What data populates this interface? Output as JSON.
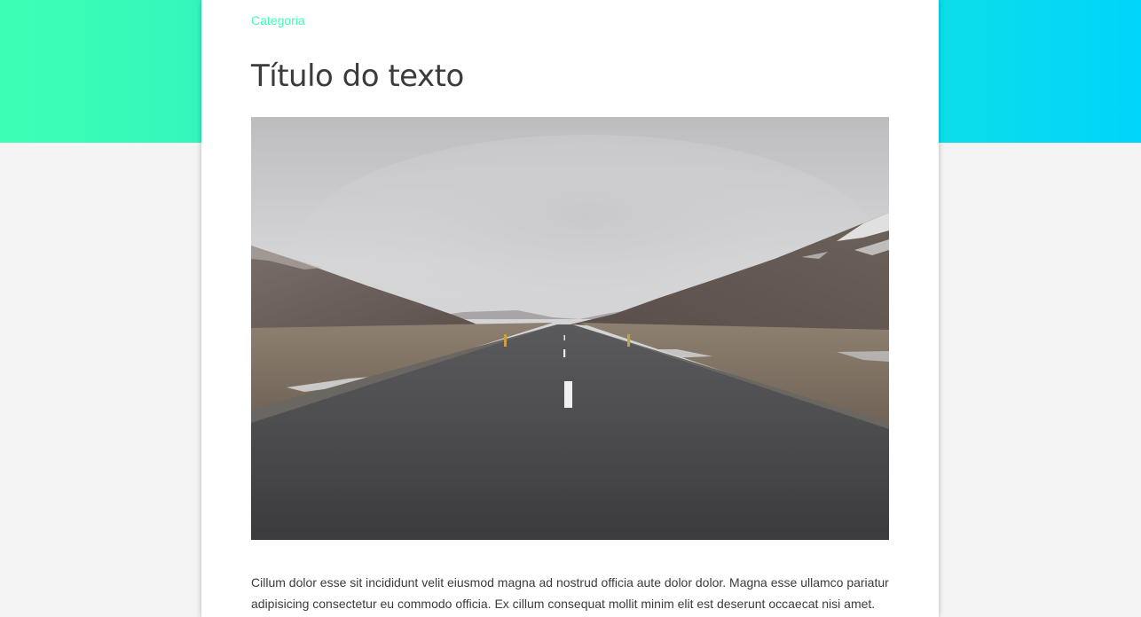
{
  "header": {
    "gradient_start": "#3dffb3",
    "gradient_end": "#00d5fb"
  },
  "article": {
    "category": "Categoria",
    "title": "Título do texto",
    "image": {
      "icon": "road-landscape-photo"
    },
    "body": "Cillum dolor esse sit incididunt velit eiusmod magna ad nostrud officia aute dolor dolor. Magna esse ullamco pariatur adipisicing consectetur eu commodo officia. Ex cillum consequat mollit minim elit est deserunt occaecat nisi amet."
  }
}
